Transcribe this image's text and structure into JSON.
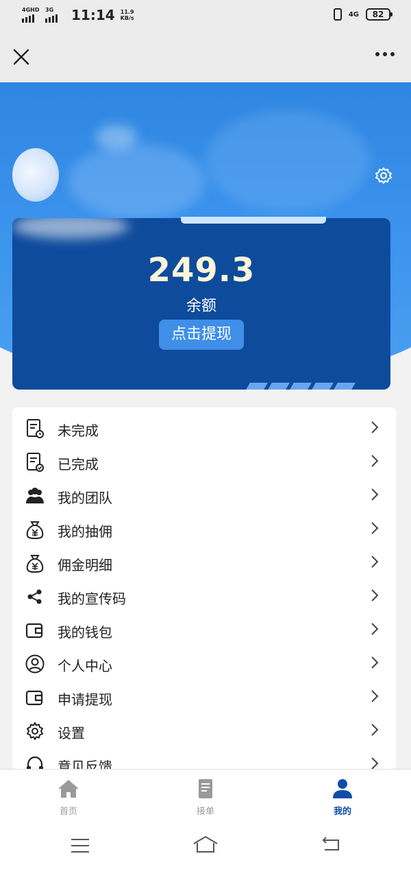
{
  "status_bar": {
    "network1": "4GHD",
    "network2": "3G",
    "time": "11:14",
    "speed_value": "11.9",
    "speed_unit": "KB/s",
    "network_type": "4G",
    "battery": "82"
  },
  "card": {
    "balance": "249.3",
    "balance_label": "余额",
    "withdraw_label": "点击提现"
  },
  "menu": [
    {
      "label": "未完成",
      "icon": "pending-document-icon"
    },
    {
      "label": "已完成",
      "icon": "completed-document-icon"
    },
    {
      "label": "我的团队",
      "icon": "team-icon"
    },
    {
      "label": "我的抽佣",
      "icon": "money-bag-icon"
    },
    {
      "label": "佣金明细",
      "icon": "money-bag-icon"
    },
    {
      "label": "我的宣传码",
      "icon": "share-icon"
    },
    {
      "label": "我的钱包",
      "icon": "wallet-icon"
    },
    {
      "label": "个人中心",
      "icon": "user-circle-icon"
    },
    {
      "label": "申请提现",
      "icon": "wallet-icon"
    },
    {
      "label": "设置",
      "icon": "gear-icon"
    },
    {
      "label": "意见反馈",
      "icon": "headset-icon"
    }
  ],
  "tabs": [
    {
      "label": "首页",
      "icon": "home-icon",
      "active": false
    },
    {
      "label": "接单",
      "icon": "document-icon",
      "active": false
    },
    {
      "label": "我的",
      "icon": "user-icon",
      "active": true
    }
  ],
  "colors": {
    "brand_blue": "#0e4b9c",
    "active_tab": "#0d4fa8",
    "inactive_tab": "#9a9a9a",
    "balance_text": "#fbf4d9"
  }
}
